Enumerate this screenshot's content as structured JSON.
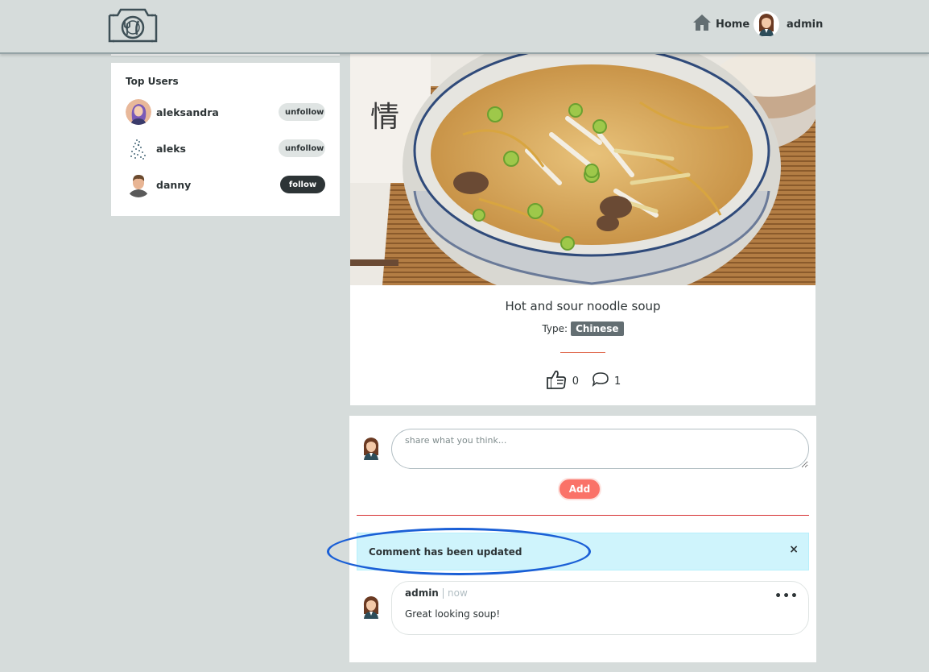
{
  "navbar": {
    "home_label": "Home",
    "user_label": "admin"
  },
  "top_users": {
    "title": "Top Users",
    "users": [
      {
        "name": "aleksandra",
        "action": "unfollow"
      },
      {
        "name": "aleks",
        "action": "unfollow"
      },
      {
        "name": "danny",
        "action": "follow"
      }
    ]
  },
  "recipe": {
    "title": "Hot and sour noodle soup",
    "type_label": "Type:",
    "type_value": "Chinese",
    "likes": "0",
    "comments": "1"
  },
  "comment_form": {
    "placeholder": "share what you think...",
    "add_label": "Add"
  },
  "alert": {
    "message": "Comment has been updated",
    "close": "×"
  },
  "comment": {
    "author": "admin",
    "time": "now",
    "text": "Great looking soup!",
    "menu": "•••"
  },
  "colors": {
    "accent": "#fa7268",
    "navbar_bg": "#d6dcdb",
    "alert_bg": "#cff4fc",
    "annotation": "#1a5fd6"
  }
}
